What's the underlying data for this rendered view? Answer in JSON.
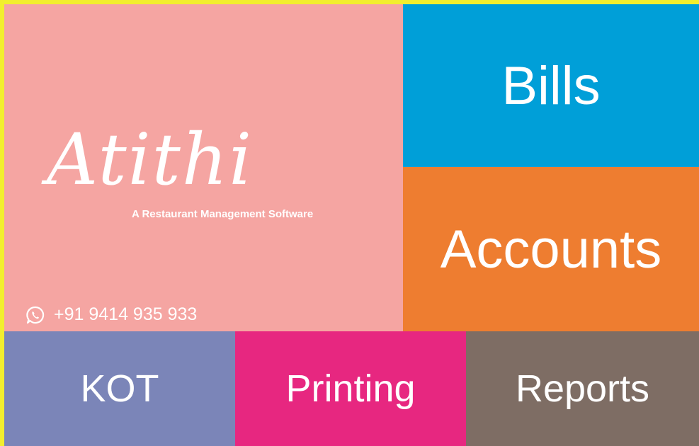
{
  "brand": {
    "logo_text": "Atithi",
    "tagline": "A Restaurant Management Software",
    "phone_icon": "whatsapp-icon",
    "phone": "+91 9414 935 933"
  },
  "tiles": {
    "bills": "Bills",
    "accounts": "Accounts",
    "kot": "KOT",
    "printing": "Printing",
    "reports": "Reports"
  },
  "colors": {
    "frame": "#f2ee2e",
    "brand_bg": "#f5a5a2",
    "bills": "#009fd8",
    "accounts": "#ee7d30",
    "kot": "#7b85b8",
    "printing": "#e72780",
    "reports": "#7e6d64"
  }
}
